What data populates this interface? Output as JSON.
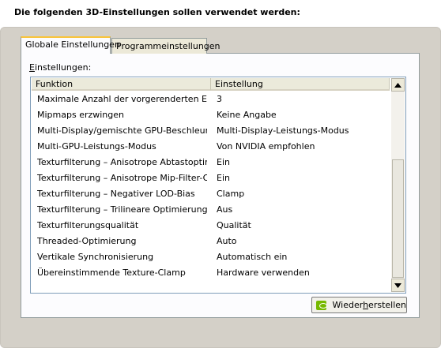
{
  "dialog": {
    "heading": "Die folgenden 3D-Einstellungen sollen verwendet werden:"
  },
  "tabs": [
    {
      "label": "Globale Einstellungen",
      "selected": true
    },
    {
      "label": "Programmeinstellungen",
      "selected": false
    }
  ],
  "settings_group": {
    "label_prefix": "E",
    "label_rest": "instellungen:"
  },
  "table": {
    "columns": [
      "Funktion",
      "Einstellung"
    ],
    "rows": [
      {
        "feature": "Maximale Anzahl der vorgerenderten Einz...",
        "value": "3"
      },
      {
        "feature": "Mipmaps erzwingen",
        "value": "Keine Angabe"
      },
      {
        "feature": "Multi-Display/gemischte GPU-Beschleunigung",
        "value": "Multi-Display-Leistungs-Modus"
      },
      {
        "feature": "Multi-GPU-Leistungs-Modus",
        "value": "Von NVIDIA empfohlen"
      },
      {
        "feature": "Texturfilterung – Anisotrope Abtastoptimi...",
        "value": "Ein"
      },
      {
        "feature": "Texturfilterung – Anisotrope Mip-Filter-Op...",
        "value": "Ein"
      },
      {
        "feature": "Texturfilterung – Negativer LOD-Bias",
        "value": "Clamp"
      },
      {
        "feature": "Texturfilterung – Trilineare Optimierung",
        "value": "Aus"
      },
      {
        "feature": "Texturfilterungsqualität",
        "value": "Qualität"
      },
      {
        "feature": "Threaded-Optimierung",
        "value": "Auto"
      },
      {
        "feature": "Vertikale Synchronisierung",
        "value": "Automatisch ein"
      },
      {
        "feature": "Übereinstimmende Texture-Clamp",
        "value": "Hardware verwenden"
      }
    ]
  },
  "buttons": {
    "restore_before": "Wieder",
    "restore_mnemonic": "h",
    "restore_after": "erstellen",
    "restore_icon": "nvidia-logo-icon"
  },
  "colors": {
    "panel_bg": "#d4d0c8",
    "tab_accent": "#f9c43a",
    "nvidia_green": "#76b900",
    "list_border": "#7f9db9"
  }
}
